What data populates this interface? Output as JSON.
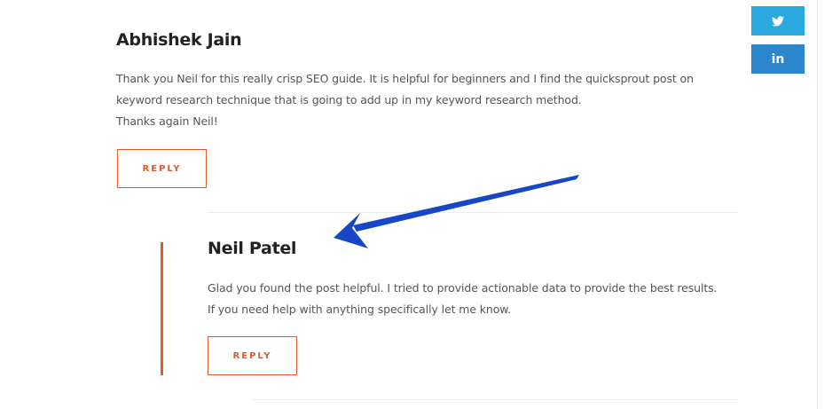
{
  "colors": {
    "accent": "#e05a2b",
    "twitter": "#2aa9e0",
    "linkedin": "#2b86cc",
    "annotation_arrow": "#1746c8"
  },
  "share": {
    "twitter_icon": "twitter-bird-icon",
    "linkedin_icon": "linkedin-icon",
    "linkedin_label": "in"
  },
  "comments": [
    {
      "author": "Abhishek Jain",
      "lines": [
        "Thank you Neil for this really crisp SEO guide. It is helpful for beginners and I find the quicksprout post on",
        "keyword research technique that is going to add up in my keyword research method.",
        "Thanks again Neil!"
      ],
      "reply_label": "REPLY"
    },
    {
      "author": "Neil Patel",
      "lines": [
        "Glad you found the post helpful. I tried to provide actionable data to provide the best results.",
        "If you need help with anything specifically let me know."
      ],
      "reply_label": "REPLY"
    }
  ]
}
